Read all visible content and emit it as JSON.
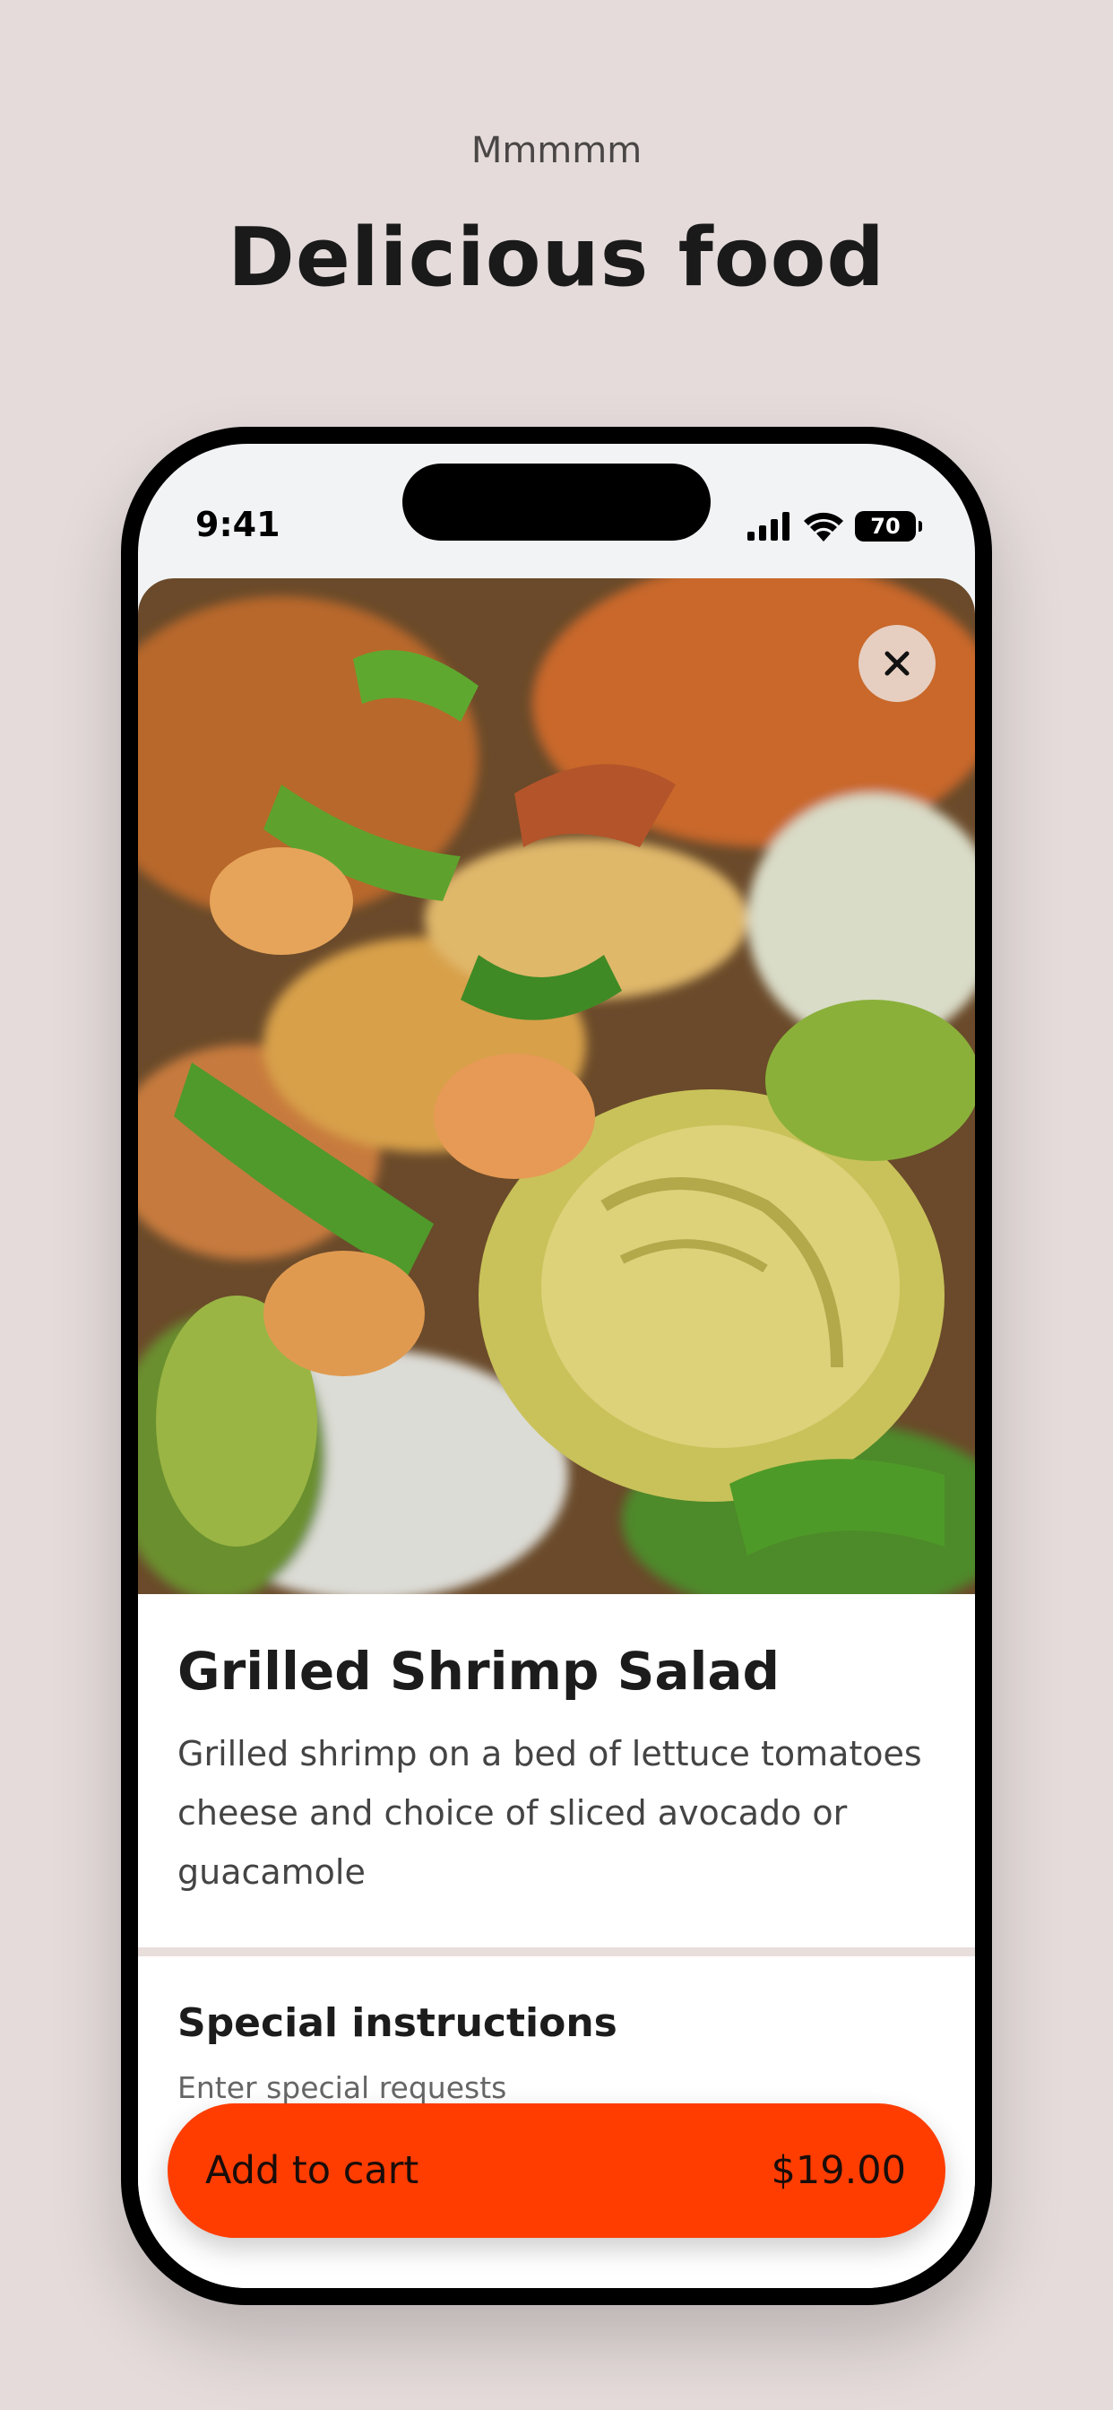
{
  "header": {
    "eyebrow": "Mmmmm",
    "headline": "Delicious food"
  },
  "status_bar": {
    "time": "9:41",
    "battery": "70",
    "icons": [
      "signal-icon",
      "wifi-icon",
      "battery-icon"
    ]
  },
  "product": {
    "image": "grilled-shrimp-salad-photo",
    "title": "Grilled Shrimp Salad",
    "description": "Grilled shrimp on a bed of lettuce tomatoes cheese and choice of sliced avocado or guacamole"
  },
  "special_instructions": {
    "title": "Special instructions",
    "placeholder": "Enter special requests"
  },
  "cart": {
    "label": "Add to cart",
    "price": "$19.00"
  },
  "colors": {
    "background": "#e4dbda",
    "accent": "#ff3d00"
  }
}
